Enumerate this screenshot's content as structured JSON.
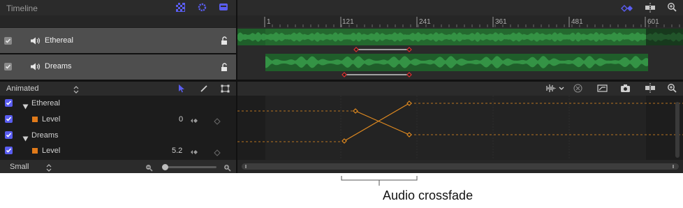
{
  "header": {
    "title": "Timeline"
  },
  "ruler": {
    "ticks": [
      "1",
      "121",
      "241",
      "361",
      "481",
      "601"
    ]
  },
  "tracks": [
    {
      "name": "Ethereal"
    },
    {
      "name": "Dreams"
    }
  ],
  "curve_editor": {
    "mode_label": "Animated",
    "rows": [
      {
        "label": "Ethereal",
        "type": "group"
      },
      {
        "label": "Level",
        "value": "0",
        "type": "param"
      },
      {
        "label": "Dreams",
        "type": "group"
      },
      {
        "label": "Level",
        "value": "5.2",
        "type": "param"
      }
    ]
  },
  "footer": {
    "size_label": "Small"
  },
  "annotation": {
    "label": "Audio crossfade"
  },
  "colors": {
    "accent": "#5a5df0",
    "waveform": "#2e8b3d",
    "keyframe": "#e03030",
    "curve": "#e08a20",
    "param_swatch": "#e07a1a"
  }
}
